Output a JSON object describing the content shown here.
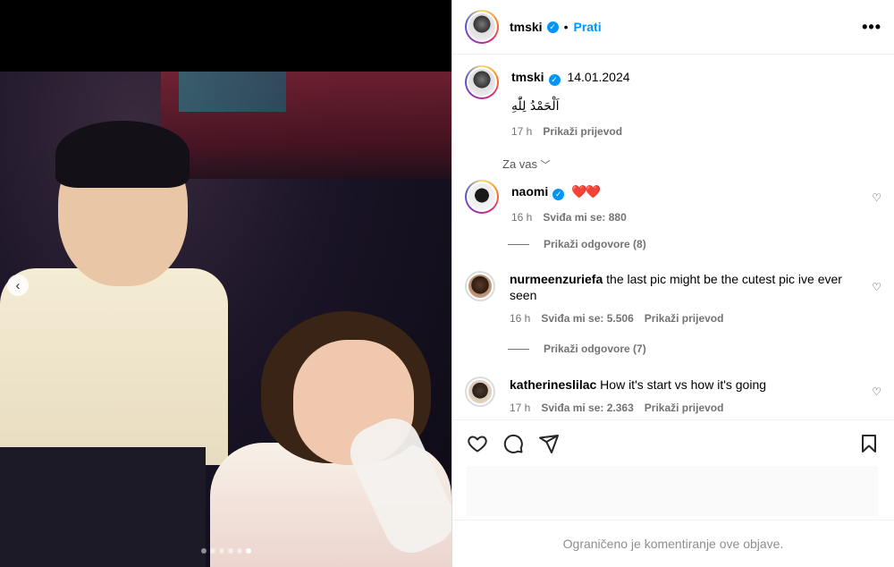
{
  "post": {
    "username": "tmski",
    "follow_label": "Prati",
    "dot": "•",
    "more_icon": "more-horizontal-icon",
    "carousel": {
      "slide_count": 6,
      "active_index": 5
    }
  },
  "caption": {
    "username": "tmski",
    "date": "14.01.2024",
    "text": "اَلْحَمْدُ لِلّٰهِ",
    "time": "17 h",
    "translate_label": "Prikaži prijevod"
  },
  "for_you_label": "Za vas",
  "comments": [
    {
      "username": "naomi",
      "verified": true,
      "text": "❤️❤️",
      "time": "16 h",
      "likes": "Sviđa mi se: 880",
      "translate": "",
      "replies": "Prikaži odgovore (8)"
    },
    {
      "username": "nurmeenzuriefa",
      "verified": false,
      "text": "the last pic might be the cutest pic ive ever seen",
      "time": "16 h",
      "likes": "Sviđa mi se: 5.506",
      "translate": "Prikaži prijevod",
      "replies": "Prikaži odgovore (7)"
    },
    {
      "username": "katherineslilac",
      "verified": false,
      "text": "How it's start vs how it's going",
      "time": "17 h",
      "likes": "Sviđa mi se: 2.363",
      "translate": "Prikaži prijevod",
      "replies": ""
    }
  ],
  "footer": {
    "text": "Ograničeno je komentiranje ove objave."
  },
  "icons": {
    "like": "heart-icon",
    "comment": "comment-icon",
    "share": "share-icon",
    "save": "bookmark-icon"
  },
  "colors": {
    "accent": "#0095f6",
    "muted": "#737373",
    "heart_red": "#ed1c24"
  }
}
